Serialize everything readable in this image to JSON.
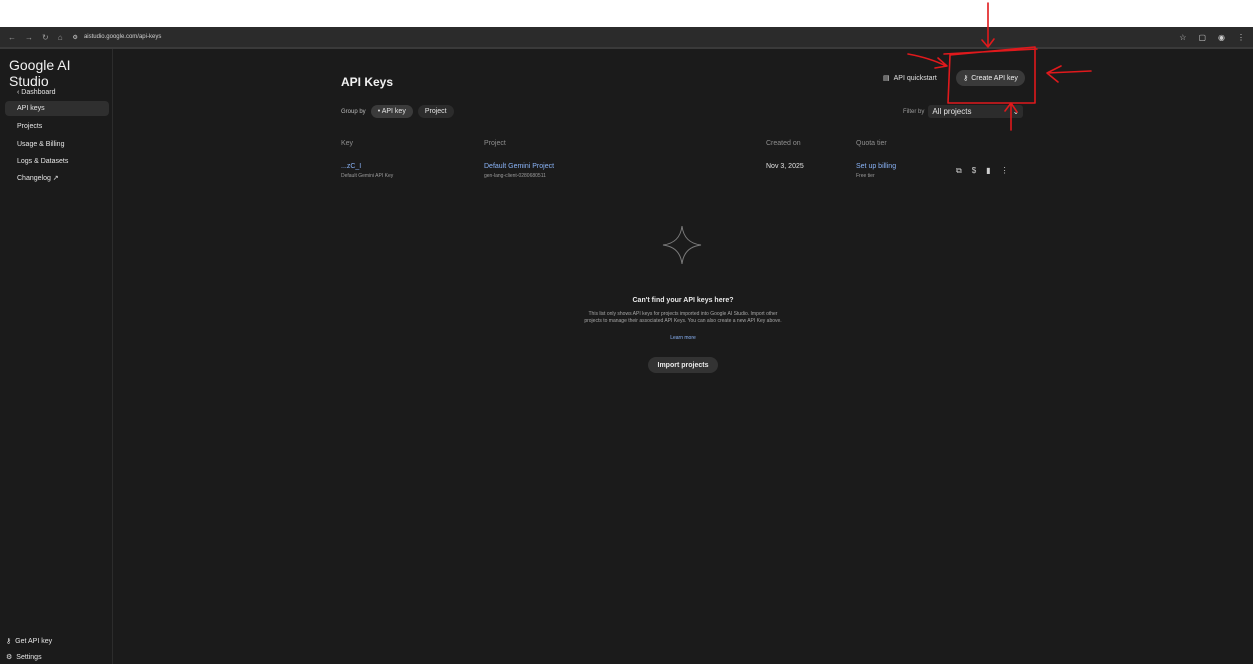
{
  "browser": {
    "url": "aistudio.google.com/api-keys",
    "nav_icons": [
      "back-icon",
      "forward-icon",
      "reload-icon",
      "home-icon"
    ],
    "right_icons": [
      "star-icon",
      "extensions-icon",
      "profile-icon",
      "menu-icon"
    ]
  },
  "sidebar": {
    "brand": "Google AI Studio",
    "items": [
      {
        "label": "‹  Dashboard"
      },
      {
        "label": "API keys",
        "active": true
      },
      {
        "label": "Projects"
      },
      {
        "label": "Usage & Billing"
      },
      {
        "label": "Logs & Datasets"
      },
      {
        "label": "Changelog ↗"
      }
    ],
    "get_api_key": "Get API key",
    "settings": "Settings"
  },
  "header": {
    "title": "API Keys",
    "quickstart": "API quickstart",
    "create_button": "Create API key"
  },
  "toolbar": {
    "group_by_label": "Group by",
    "group_api_key": "API key",
    "group_project": "Project",
    "filter_label": "Filter by",
    "filter_value": "All projects"
  },
  "table": {
    "columns": [
      "Key",
      "Project",
      "Created on",
      "Quota tier"
    ],
    "rows": [
      {
        "key": "...zC_I",
        "key_sub": "Default Gemini API Key",
        "project": "Default Gemini Project",
        "project_sub": "gen-lang-client-0280680511",
        "created": "Nov 3, 2025",
        "quota": "Set up billing",
        "quota_sub": "Free tier"
      }
    ]
  },
  "empty_state": {
    "title": "Can't find your API keys here?",
    "body": "This list only shows API keys for projects imported into Google AI Studio. Import other projects to manage their associated API Keys. You can also create a new API Key above.",
    "learn_more": "Learn more",
    "import_button": "Import projects"
  },
  "colors": {
    "background": "#1b1b1b",
    "link": "#8ab4f8",
    "annotation": "#e0191c"
  }
}
